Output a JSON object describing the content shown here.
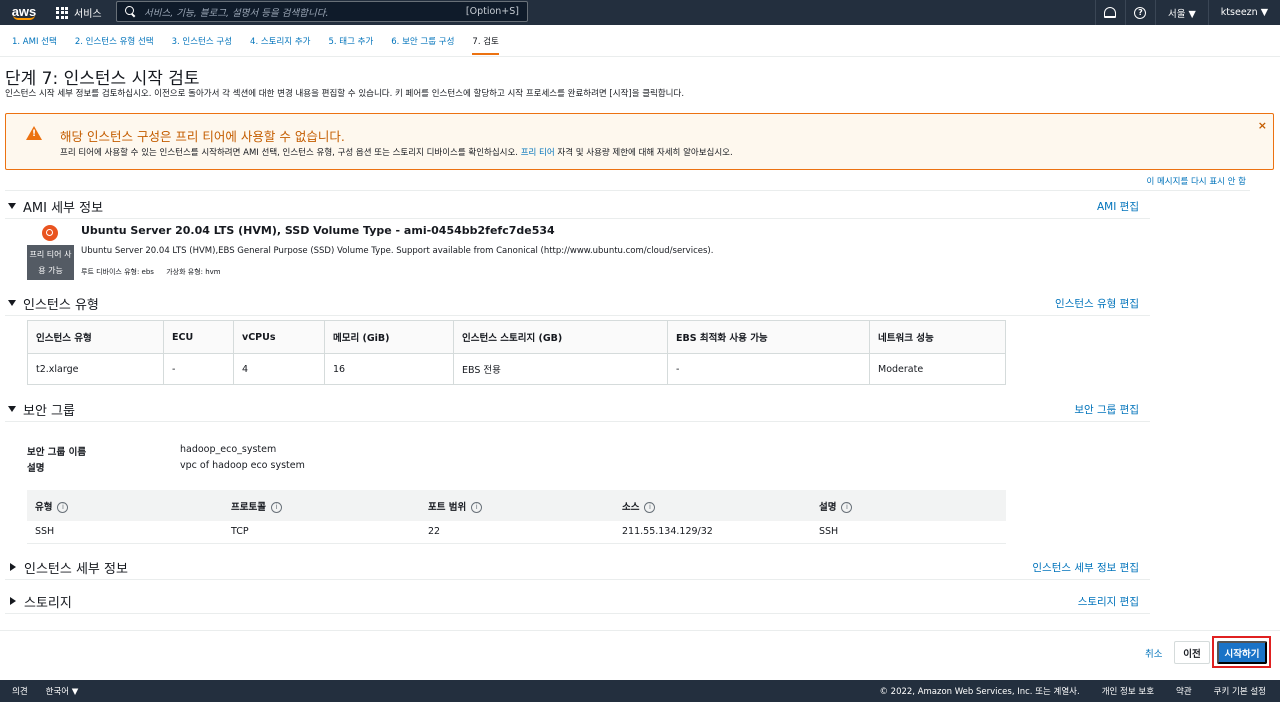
{
  "nav": {
    "logo": "aws",
    "services": "서비스",
    "search_placeholder": "서비스, 기능, 블로그, 설명서 등을 검색합니다.",
    "search_shortcut": "[Option+S]",
    "region": "서울 ▼",
    "account": "ktseezn ▼"
  },
  "steps": [
    {
      "label": "1. AMI 선택"
    },
    {
      "label": "2. 인스턴스 유형 선택"
    },
    {
      "label": "3. 인스턴스 구성"
    },
    {
      "label": "4. 스토리지 추가"
    },
    {
      "label": "5. 태그 추가"
    },
    {
      "label": "6. 보안 그룹 구성"
    },
    {
      "label": "7. 검토"
    }
  ],
  "page": {
    "title": "단계 7: 인스턴스 시작 검토",
    "description": "인스턴스 시작 세부 정보를 검토하십시오. 이전으로 돌아가서 각 섹션에 대한 변경 내용을 편집할 수 있습니다. 키 페어를 인스턴스에 할당하고 시작 프로세스를 완료하려면 [시작]을 클릭합니다."
  },
  "alert": {
    "title": "해당 인스턴스 구성은 프리 티어에 사용할 수 없습니다.",
    "body_prefix": "프리 티어에 사용할 수 있는 인스턴스를 시작하려면 AMI 선택, 인스턴스 유형, 구성 옵션 또는 스토리지 디바이스를 확인하십시오.",
    "body_link": "프리 티어",
    "body_suffix": "자격 및 사용량 제한에 대해 자세히 알아보십시오.",
    "close": "×",
    "dont_show": "이 메시지를 다시 표시 안 함"
  },
  "ami": {
    "section_title": "AMI 세부 정보",
    "edit": "AMI 편집",
    "name": "Ubuntu Server 20.04 LTS (HVM), SSD Volume Type - ami-0454bb2fefc7de534",
    "description": "Ubuntu Server 20.04 LTS (HVM),EBS General Purpose (SSD) Volume Type. Support available from Canonical (http://www.ubuntu.com/cloud/services).",
    "badge_line1": "프리 티어 사",
    "badge_line2": "용 가능",
    "root_device": "루트 디바이스 유형: ebs",
    "virtualization": "가상화 유형: hvm"
  },
  "instance_type": {
    "section_title": "인스턴스 유형",
    "edit": "인스턴스 유형 편집",
    "headers": [
      "인스턴스 유형",
      "ECU",
      "vCPUs",
      "메모리 (GiB)",
      "인스턴스 스토리지 (GB)",
      "EBS 최적화 사용 가능",
      "네트워크 성능"
    ],
    "row": [
      "t2.xlarge",
      "-",
      "4",
      "16",
      "EBS 전용",
      "-",
      "Moderate"
    ]
  },
  "security_group": {
    "section_title": "보안 그룹",
    "edit": "보안 그룹 편집",
    "name_label": "보안 그룹 이름",
    "name_value": "hadoop_eco_system",
    "desc_label": "설명",
    "desc_value": "vpc of hadoop eco system",
    "headers": [
      "유형",
      "프로토콜",
      "포트 범위",
      "소스",
      "설명"
    ],
    "row": [
      "SSH",
      "TCP",
      "22",
      "211.55.134.129/32",
      "SSH"
    ]
  },
  "instance_details": {
    "section_title": "인스턴스 세부 정보",
    "edit": "인스턴스 세부 정보 편집"
  },
  "storage": {
    "section_title": "스토리지",
    "edit": "스토리지 편집"
  },
  "actions": {
    "cancel": "취소",
    "previous": "이전",
    "launch": "시작하기"
  },
  "footer": {
    "feedback": "의견",
    "language": "한국어 ▼",
    "copyright": "© 2022, Amazon Web Services, Inc. 또는 계열사.",
    "privacy": "개인 정보 보호",
    "terms": "약관",
    "cookies": "쿠키 기본 설정"
  }
}
